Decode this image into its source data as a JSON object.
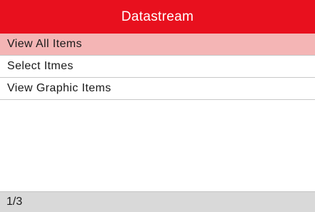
{
  "header": {
    "title": "Datastream"
  },
  "menu": {
    "items": [
      {
        "label": "View All Items",
        "selected": true
      },
      {
        "label": "Select Itmes",
        "selected": false
      },
      {
        "label": "View Graphic Items",
        "selected": false
      }
    ]
  },
  "footer": {
    "page_indicator": "1/3"
  },
  "colors": {
    "header_background": "#e8101e",
    "header_text": "#ffffff",
    "selected_row": "#f4b5b5",
    "status_bar": "#d9d9d9"
  }
}
